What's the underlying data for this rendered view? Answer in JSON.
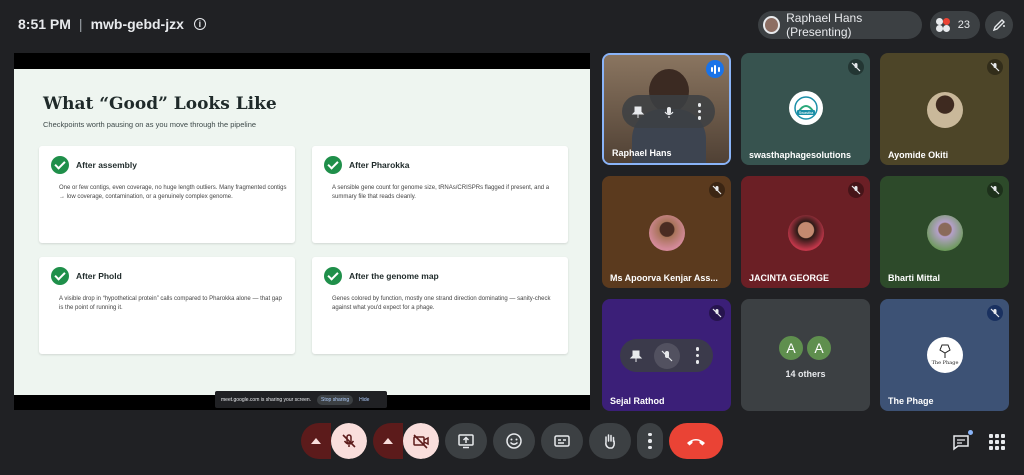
{
  "meeting": {
    "time": "8:51 PM",
    "separator": "|",
    "code": "mwb-gebd-jzx",
    "info_icon": "i"
  },
  "presenter_chip": {
    "label": "Raphael Hans (Presenting)"
  },
  "people": {
    "count": "23"
  },
  "slide": {
    "title": "What “Good” Looks Like",
    "subtitle": "Checkpoints worth pausing on as you move through the pipeline",
    "cards": [
      {
        "title": "After assembly",
        "body": "One or few contigs, even coverage, no huge length outliers. Many fragmented contigs → low coverage, contamination, or a genuinely complex genome."
      },
      {
        "title": "After Pharokka",
        "body": "A sensible gene count for genome size, tRNAs/CRISPRs flagged if present, and a summary file that reads cleanly."
      },
      {
        "title": "After Phold",
        "body": "A visible drop in “hypothetical protein” calls compared to Pharokka alone — that gap is the point of running it."
      },
      {
        "title": "After the genome map",
        "body": "Genes colored by function, mostly one strand direction dominating — sanity-check against what you'd expect for a phage."
      }
    ]
  },
  "share_bar": {
    "text": "meet.google.com is sharing your screen.",
    "stop_label": "Stop sharing",
    "hide_label": "Hide"
  },
  "participants": [
    {
      "name": "Raphael Hans"
    },
    {
      "name": "swasthaphagesolutions",
      "logo": "Swastha"
    },
    {
      "name": "Ayomide Okiti"
    },
    {
      "name": "Ms Apoorva Kenjar Ass..."
    },
    {
      "name": "JACINTA GEORGE"
    },
    {
      "name": "Bharti Mittal"
    },
    {
      "name": "Sejal Rathod"
    },
    {
      "name": "14 others",
      "initials": [
        "A",
        "A"
      ]
    },
    {
      "name": "The Phage",
      "logo": "The Phage"
    }
  ],
  "colors": {
    "background": "#202124",
    "end_call": "#ea4335",
    "accent": "#8ab4f8",
    "check": "#1f8f4a"
  }
}
